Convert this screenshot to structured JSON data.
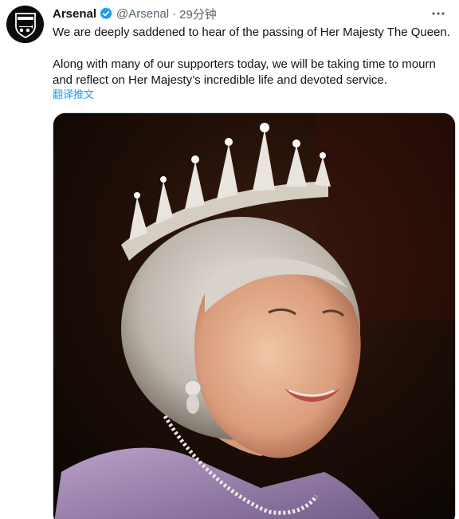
{
  "tweet": {
    "author": {
      "display_name": "Arsenal",
      "handle": "@Arsenal",
      "avatar_icon": "arsenal-crest-icon",
      "verified": true,
      "verified_icon": "verified-badge-icon"
    },
    "separator": "·",
    "time": "29分钟",
    "more_icon": "more-options-icon",
    "text": {
      "line1": "We are deeply saddened to hear of the passing of Her Majesty The Queen.",
      "line2": "Along with many of our supporters today, we will be taking time to mourn",
      "line3": "and reflect on Her Majesty’s incredible life and devoted service."
    },
    "translate_label": "翻译推文",
    "media": {
      "type": "photo"
    }
  },
  "colors": {
    "text": "#0f1419",
    "secondary": "#536471",
    "link": "#1d9bf0",
    "verified": "#1d9bf0",
    "border": "#cfd9de"
  }
}
